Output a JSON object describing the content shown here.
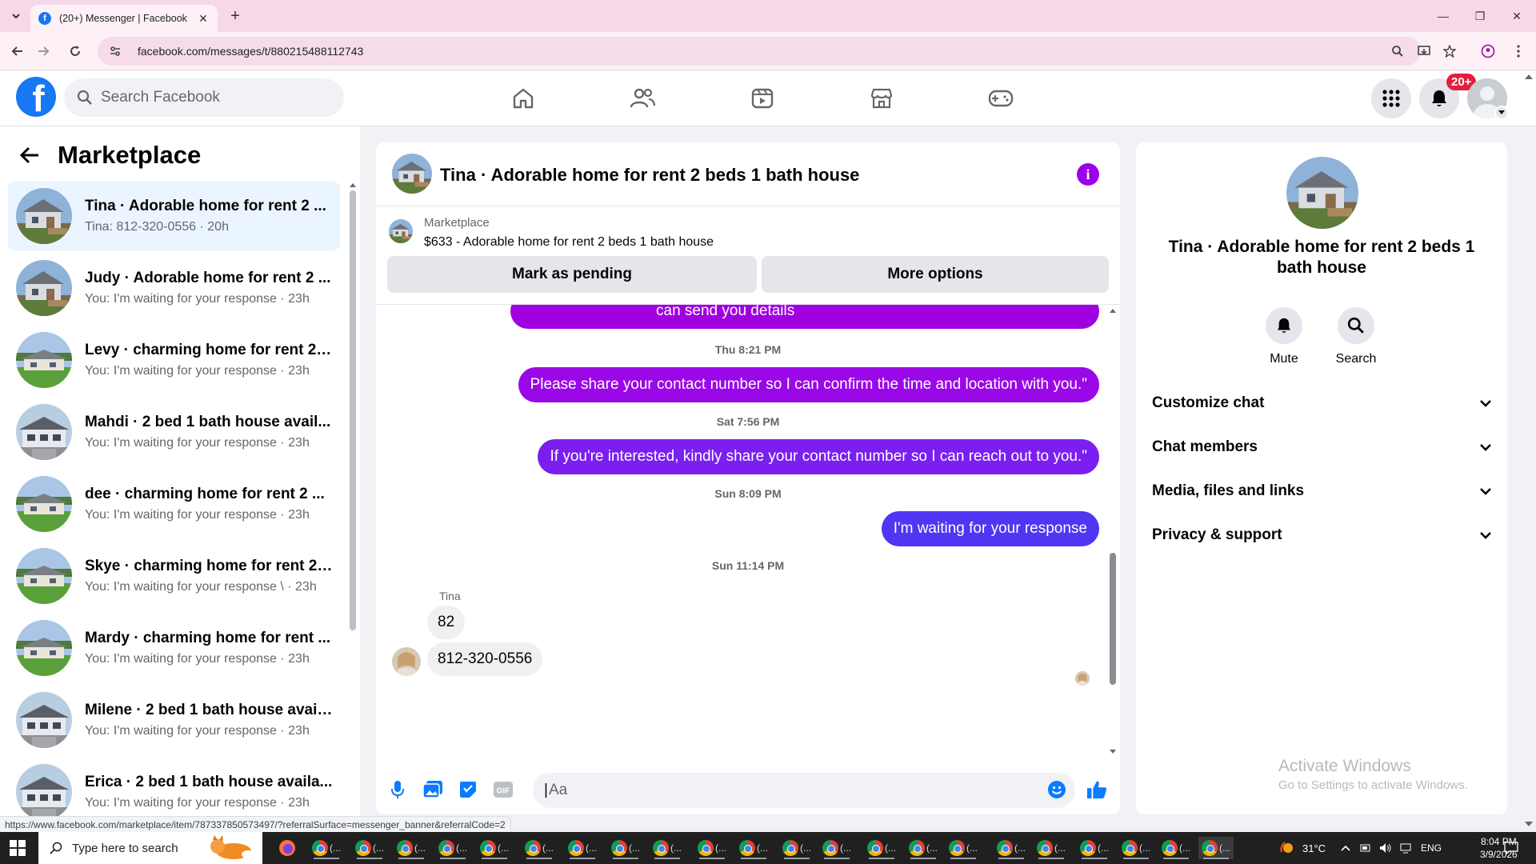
{
  "browser": {
    "tab_title": "(20+) Messenger | Facebook",
    "url": "facebook.com/messages/t/880215488112743",
    "status_url": "https://www.facebook.com/marketplace/item/787337850573497/?referralSurface=messenger_banner&referralCode=2"
  },
  "fb_nav": {
    "search_placeholder": "Search Facebook",
    "notification_count": "20+",
    "tabs": [
      "home-icon",
      "friends-icon",
      "watch-icon",
      "marketplace-icon",
      "gaming-icon"
    ]
  },
  "sidebar": {
    "title": "Marketplace",
    "conversations": [
      {
        "name": "Tina · Adorable home for rent 2 ...",
        "sub": "Tina: 812-320-0556 · 20h",
        "thumb": "house-a"
      },
      {
        "name": "Judy · Adorable home for rent 2 ...",
        "sub": "You: I'm waiting for your response · 23h",
        "thumb": "house-a"
      },
      {
        "name": "Levy · charming home for rent 2 ...",
        "sub": "You: I'm waiting for your response · 23h",
        "thumb": "house-b"
      },
      {
        "name": "Mahdi · 2 bed 1 bath house avail...",
        "sub": "You: I'm waiting for your response · 23h",
        "thumb": "house-c"
      },
      {
        "name": "dee · charming home for rent 2 ...",
        "sub": "You: I'm waiting for your response · 23h",
        "thumb": "house-b"
      },
      {
        "name": "Skye · charming home for rent 2 ...",
        "sub": "You: I'm waiting for your response \\ · 23h",
        "thumb": "house-b"
      },
      {
        "name": "Mardy · charming home for rent ...",
        "sub": "You: I'm waiting for your response · 23h",
        "thumb": "house-b"
      },
      {
        "name": "Milene · 2 bed 1 bath house avail...",
        "sub": "You: I'm waiting for your response · 23h",
        "thumb": "house-c"
      },
      {
        "name": "Erica · 2 bed 1 bath house availa...",
        "sub": "You: I'm waiting for your response · 23h",
        "thumb": "house-c"
      }
    ]
  },
  "chat": {
    "title": "Tina · Adorable home for rent 2 beds 1 bath house",
    "marketplace_label": "Marketplace",
    "item": "$633 - Adorable home for rent 2 beds 1 bath house",
    "mark_pending": "Mark as pending",
    "more_options": "More options",
    "partial_message": "can send you details",
    "messages": [
      {
        "ts": "Thu 8:21 PM",
        "text": "Please share your contact number so I can confirm the time and location with you.\""
      },
      {
        "ts": "Sat 7:56 PM",
        "text": "If you're interested, kindly share your contact number so I can reach out to you.\""
      },
      {
        "ts": "Sun 8:09 PM",
        "text": "I'm waiting for your response"
      }
    ],
    "incoming_ts": "Sun 11:14 PM",
    "incoming_sender": "Tina",
    "incoming": [
      "82",
      "812-320-0556"
    ],
    "composer_placeholder": "Aa"
  },
  "info_panel": {
    "name": "Tina · Adorable home for rent 2 beds 1 bath house",
    "actions": [
      {
        "label": "Mute",
        "icon": "bell-icon"
      },
      {
        "label": "Search",
        "icon": "search-icon"
      }
    ],
    "sections": [
      "Customize chat",
      "Chat members",
      "Media, files and links",
      "Privacy & support"
    ],
    "activate_title": "Activate Windows",
    "activate_sub": "Go to Settings to activate Windows."
  },
  "taskbar": {
    "search_placeholder": "Type here to search",
    "weather": "31°C",
    "lang": "ENG",
    "time": "8:04 PM",
    "date": "3/9/2026"
  },
  "colors": {
    "fb_blue": "#1877f2",
    "bubble_purple_1": "#a000e0",
    "bubble_purple_2": "#8a14f0",
    "bubble_purple_3": "#6a2cf0",
    "bubble_blue": "#4a3af5",
    "badge_red": "#e41e3f"
  }
}
